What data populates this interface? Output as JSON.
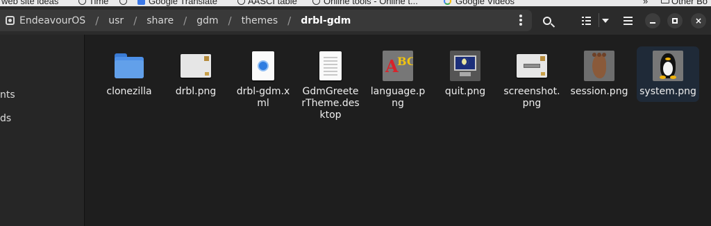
{
  "bookmarks": [
    {
      "label": "web site ideas",
      "icon": "folder-icon"
    },
    {
      "label": "Time",
      "icon": "globe-icon"
    },
    {
      "label": "Google Translate",
      "icon": "translate-icon"
    },
    {
      "label": "AASCI table",
      "icon": "globe-icon"
    },
    {
      "label": "Online tools - Online t...",
      "icon": "globe-icon"
    },
    {
      "label": "Google Videos",
      "icon": "google-icon"
    },
    {
      "label": "»",
      "icon": ""
    },
    {
      "label": "Other Bo",
      "icon": "folder-icon"
    }
  ],
  "pathbar": {
    "crumbs": [
      "EndeavourOS",
      "usr",
      "share",
      "gdm",
      "themes",
      "drbl-gdm"
    ],
    "separator": "/"
  },
  "header": {
    "close_symbol": "×"
  },
  "sidebar": {
    "items": [
      "nts",
      "ds"
    ]
  },
  "files": [
    {
      "name": "clonezilla",
      "icon": "folder-icon"
    },
    {
      "name": "drbl.png",
      "icon": "image-thumbnail-icon"
    },
    {
      "name": "drbl-gdm.xml",
      "icon": "xml-document-icon"
    },
    {
      "name": "GdmGreeterTheme.desktop",
      "icon": "text-document-icon"
    },
    {
      "name": "language.png",
      "icon": "language-abc-icon"
    },
    {
      "name": "quit.png",
      "icon": "monitor-moon-icon"
    },
    {
      "name": "screenshot.png",
      "icon": "image-thumbnail-icon"
    },
    {
      "name": "session.png",
      "icon": "footprint-icon"
    },
    {
      "name": "system.png",
      "icon": "tux-penguin-icon",
      "selected": true
    }
  ],
  "colors": {
    "background": "#1e1e1e",
    "headerbar": "#2b2b2b",
    "pathbar": "#393939",
    "selection": "#1f2a38",
    "folder": "#62a0ea"
  }
}
